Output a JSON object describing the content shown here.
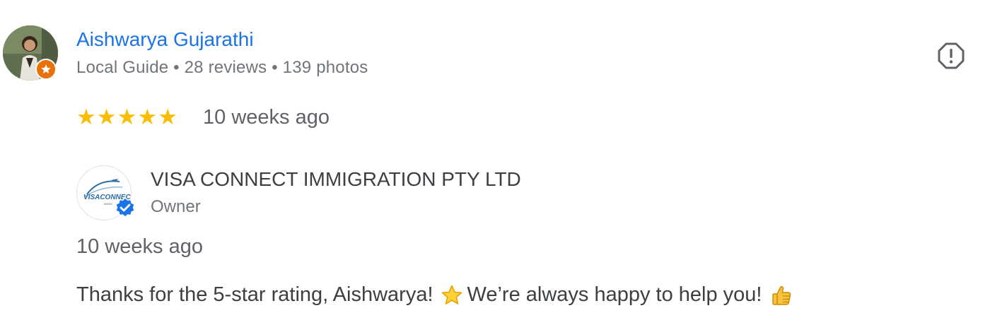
{
  "reviewer": {
    "name": "Aishwarya Gujarathi",
    "meta": "Local Guide • 28 reviews • 139 photos",
    "avatar_icon": "person-photo",
    "badge_icon": "local-guide-star-icon"
  },
  "review": {
    "rating": 5,
    "rating_max": 5,
    "stars": [
      "★",
      "★",
      "★",
      "★",
      "★"
    ],
    "time": "10 weeks ago"
  },
  "report_icon": "report-icon",
  "owner_reply": {
    "owner_name": "VISA CONNECT IMMIGRATION PTY LTD",
    "role": "Owner",
    "logo_text": "VISACONNECT",
    "logo_subtext": "IMMIG",
    "verified_icon": "verified-badge-icon",
    "time": "10 weeks ago",
    "text_part1": "Thanks for the 5-star rating, Aishwarya!",
    "text_part2": "We’re always happy to help you!",
    "emoji1": "star-emoji",
    "emoji2": "thumbs-up-emoji"
  },
  "colors": {
    "name_link": "#1a73e8",
    "star": "#fbbc04",
    "local_guide_badge": "#e8710a",
    "verified": "#1a73e8",
    "meta_text": "#70757a"
  }
}
